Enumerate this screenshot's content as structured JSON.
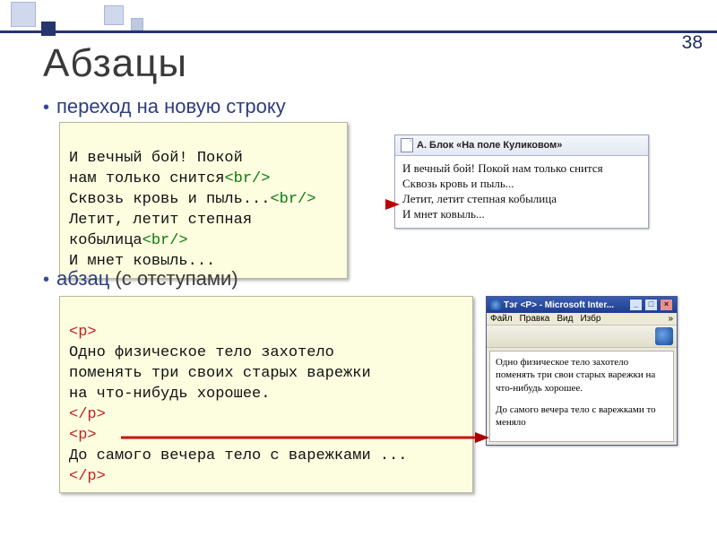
{
  "pageNumber": "38",
  "title": "Абзацы",
  "bullet1": "переход на новую строку",
  "bullet2_strong": "абзац",
  "bullet2_rest": " (с отступами)",
  "code1": {
    "line1": "И вечный бой! Покой",
    "line2a": "нам только снится",
    "line2b": "<br/>",
    "line3a": "Сквозь кровь и пыль...",
    "line3b": "<br/>",
    "line4": "Летит, летит степная",
    "line5a": "кобылица",
    "line5b": "<br/>",
    "line6": "И мнет ковыль..."
  },
  "browser1": {
    "title": "А. Блок «На поле Куликовом»",
    "l1": "И вечный бой! Покой нам только снится",
    "l2": "Сквозь кровь и пыль...",
    "l3": "Летит, летит степная кобылица",
    "l4": "И мнет ковыль..."
  },
  "code2": {
    "openp": "<p>",
    "l1": "Одно физическое тело захотело",
    "l2": "поменять три своих старых варежки",
    "l3": "на что-нибудь хорошее.",
    "closep": "</p>",
    "openp2": "<p>",
    "l4": "До самого вечера тело с варежками ...",
    "closep2": "</p>"
  },
  "iewin": {
    "title": "Тэг <P> - Microsoft Inter...",
    "menu": {
      "file": "Файл",
      "edit": "Правка",
      "view": "Вид",
      "fav": "Избр"
    },
    "p1": "Одно физическое тело захотело поменять три свои старых варежки на что-нибудь хорошее.",
    "p2": "До самого вечера тело с варежками то меняло"
  },
  "controls": {
    "min": "_",
    "max": "□",
    "close": "×"
  },
  "chevrons": "»"
}
